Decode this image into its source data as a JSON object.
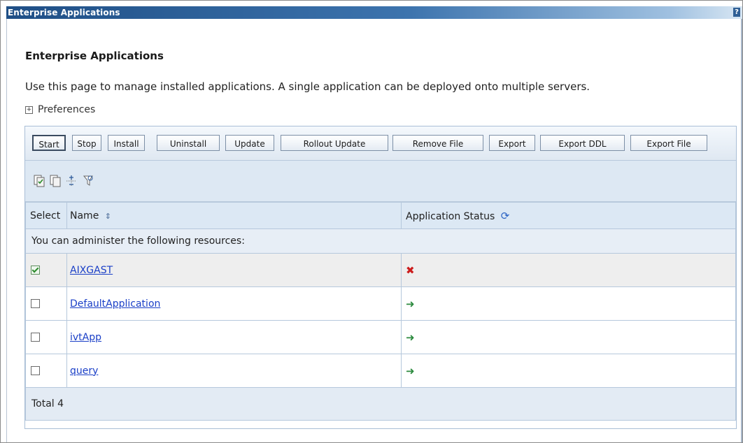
{
  "window": {
    "title": "Enterprise Applications",
    "help_label": "?"
  },
  "page": {
    "heading": "Enterprise Applications",
    "description": "Use this page to manage installed applications. A single application can be deployed onto multiple servers.",
    "preferences_label": "Preferences"
  },
  "toolbar": {
    "buttons": [
      "Start",
      "Stop",
      "Install",
      "Uninstall",
      "Update",
      "Rollout Update",
      "Remove File",
      "Export",
      "Export DDL",
      "Export File"
    ],
    "icons": [
      "select-all-icon",
      "deselect-all-icon",
      "expand-all-icon",
      "filter-icon"
    ]
  },
  "table": {
    "headers": {
      "select": "Select",
      "name": "Name",
      "status": "Application Status"
    },
    "info_row": "You can administer the following resources:",
    "rows": [
      {
        "name": "AIXGAST",
        "checked": true,
        "status": "stopped"
      },
      {
        "name": "DefaultApplication",
        "checked": false,
        "status": "started"
      },
      {
        "name": "ivtApp",
        "checked": false,
        "status": "started"
      },
      {
        "name": "query",
        "checked": false,
        "status": "started"
      }
    ],
    "total": "Total 4"
  },
  "colors": {
    "link": "#1a3fc7",
    "stopped": "#cc1c1c",
    "started": "#2b8a3e",
    "header_bg": "#dce8f4"
  }
}
